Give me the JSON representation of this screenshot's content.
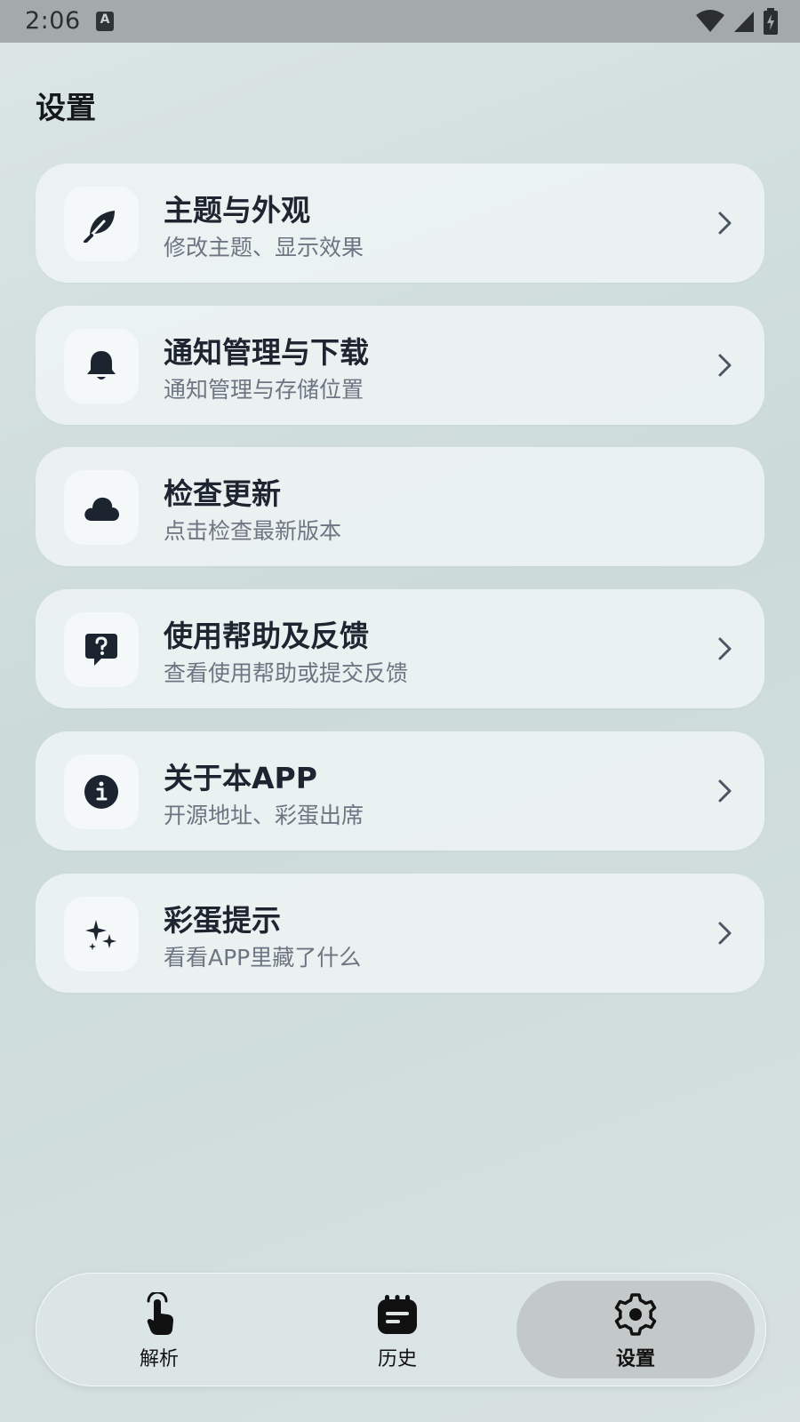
{
  "status_bar": {
    "time": "2:06",
    "a_icon": "A"
  },
  "page": {
    "title": "设置"
  },
  "settings": [
    {
      "title": "主题与外观",
      "subtitle": "修改主题、显示效果",
      "icon": "leaf-icon",
      "has_chevron": true
    },
    {
      "title": "通知管理与下载",
      "subtitle": "通知管理与存储位置",
      "icon": "bell-icon",
      "has_chevron": true
    },
    {
      "title": "检查更新",
      "subtitle": "点击检查最新版本",
      "icon": "cloud-icon",
      "has_chevron": false
    },
    {
      "title": "使用帮助及反馈",
      "subtitle": "查看使用帮助或提交反馈",
      "icon": "help-chat-icon",
      "has_chevron": true
    },
    {
      "title": "关于本APP",
      "subtitle": "开源地址、彩蛋出席",
      "icon": "info-icon",
      "has_chevron": true
    },
    {
      "title": "彩蛋提示",
      "subtitle": "看看APP里藏了什么",
      "icon": "sparkles-icon",
      "has_chevron": true
    }
  ],
  "bottom_nav": {
    "items": [
      {
        "label": "解析",
        "icon": "tap-hand-icon",
        "active": false
      },
      {
        "label": "历史",
        "icon": "calendar-icon",
        "active": false
      },
      {
        "label": "设置",
        "icon": "gear-icon",
        "active": true
      }
    ]
  },
  "colors": {
    "accent_dark": "#1c2430",
    "active_nav_bg": "#c3c8c8",
    "card_bg": "#f0f5f5"
  }
}
